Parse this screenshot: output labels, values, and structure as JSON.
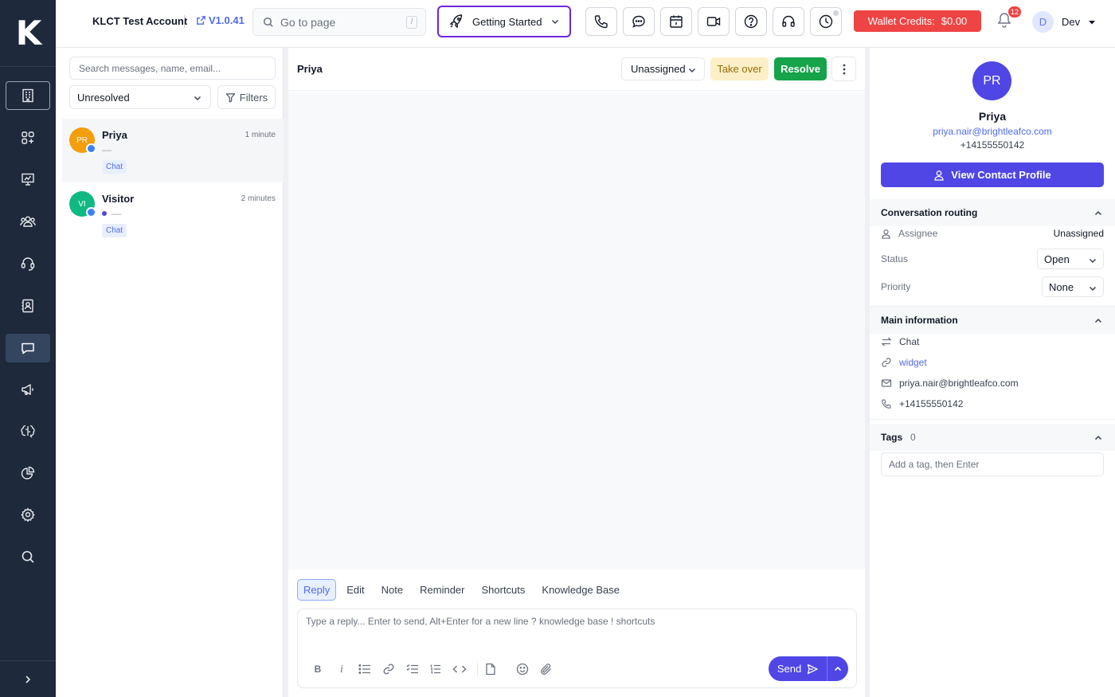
{
  "app": {
    "logo": "K"
  },
  "topbar": {
    "account": "KLCT Test Account",
    "version": "V1.0.41",
    "goto_placeholder": "Go to page",
    "goto_shortcut": "/",
    "getting_started": "Getting Started",
    "wallet_label": "Wallet Credits:",
    "wallet_amount": "$0.00",
    "notifications_count": "12",
    "user_initial": "D",
    "user_name": "Dev"
  },
  "rail": {
    "items": [
      "building-icon",
      "apps-icon",
      "presentation-icon",
      "team-icon",
      "headset-icon",
      "contacts-icon",
      "chat-icon",
      "megaphone-icon",
      "brain-icon",
      "pie-chart-icon",
      "settings-icon",
      "search-icon"
    ],
    "active": "chat-icon"
  },
  "list": {
    "search_placeholder": "Search messages, name, email...",
    "status_filter": "Unresolved",
    "filters_label": "Filters",
    "conversations": [
      {
        "initials": "PR",
        "name": "Priya",
        "time": "1 minute",
        "preview": "—",
        "tag": "Chat",
        "color": "#f59e0b"
      },
      {
        "initials": "VI",
        "name": "Visitor",
        "time": "2 minutes",
        "preview": "—",
        "tag": "Chat",
        "color": "#10b981"
      }
    ]
  },
  "chat": {
    "contact_name": "Priya",
    "assignee": "Unassigned",
    "take_over": "Take over",
    "resolve": "Resolve",
    "tabs": [
      "Reply",
      "Edit",
      "Note",
      "Reminder",
      "Shortcuts",
      "Knowledge Base"
    ],
    "active_tab": "Reply",
    "composer_placeholder": "Type a reply... Enter to send, Alt+Enter for a new line ? knowledge base ! shortcuts",
    "format_bold": "B",
    "format_italic": "i",
    "send": "Send"
  },
  "contact": {
    "initials": "PR",
    "name": "Priya",
    "email": "priya.nair@brightleafco.com",
    "phone": "+14155550142",
    "view_profile": "View Contact Profile",
    "routing": {
      "title": "Conversation routing",
      "assignee_label": "Assignee",
      "assignee_value": "Unassigned",
      "status_label": "Status",
      "status_value": "Open",
      "priority_label": "Priority",
      "priority_value": "None"
    },
    "main_info": {
      "title": "Main information",
      "channel": "Chat",
      "source": "widget",
      "email": "priya.nair@brightleafco.com",
      "phone": "+14155550142"
    },
    "tags": {
      "title": "Tags",
      "count": "0",
      "placeholder": "Add a tag, then Enter"
    }
  },
  "colors": {
    "rail_bg": "#1e2a3b",
    "accent": "#4f46e5",
    "danger": "#ef4444",
    "success": "#16a34a",
    "warning_bg": "#fdf0c8"
  }
}
